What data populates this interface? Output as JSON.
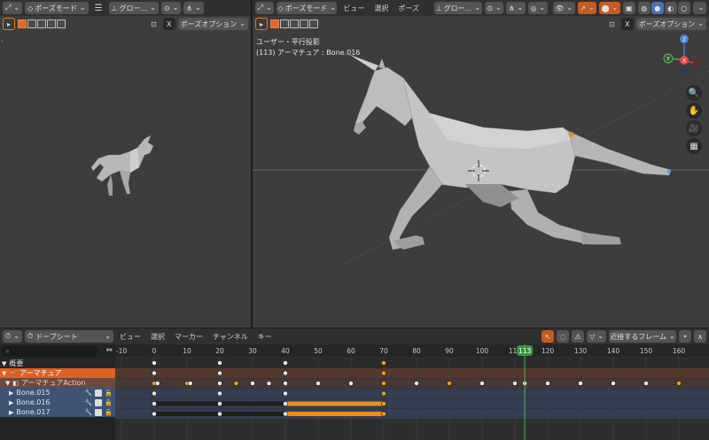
{
  "left_viewport": {
    "mode_label": "ポーズモード",
    "transform_label": "グロー...",
    "options_label": "ポーズオプション"
  },
  "main_viewport": {
    "mode_label": "ポーズモード",
    "menus": [
      "ビュー",
      "選択",
      "ポーズ"
    ],
    "transform_label": "グロー...",
    "options_label": "ポーズオプション",
    "view_info": "ユーザー・平行投影",
    "selection_info": "(113) アーマチュア : Bone.016",
    "gizmo": {
      "y": "Y",
      "x": "X",
      "z": "Z"
    }
  },
  "dopesheet": {
    "editor_label": "ドープシート",
    "menus": [
      "ビュー",
      "選択",
      "マーカー",
      "チャンネル",
      "キー"
    ],
    "snap_label": "近接するフレーム",
    "search_placeholder": "",
    "ruler_ticks": [
      -10,
      0,
      10,
      20,
      30,
      40,
      50,
      60,
      70,
      80,
      90,
      100,
      110,
      120,
      130,
      140,
      150,
      160
    ],
    "current_frame": 113,
    "channels": [
      {
        "label": "概要",
        "type": "summary"
      },
      {
        "label": "アーマチュア",
        "type": "object"
      },
      {
        "label": "アーマチュアAction",
        "type": "action"
      },
      {
        "label": "Bone.015",
        "type": "bone"
      },
      {
        "label": "Bone.016",
        "type": "bone"
      },
      {
        "label": "Bone.017",
        "type": "bone"
      }
    ],
    "keyframes": [
      {
        "row": 0,
        "frames": [
          0,
          20,
          40,
          70
        ],
        "selected": [
          70
        ]
      },
      {
        "row": 1,
        "frames": [
          0,
          20,
          40,
          70
        ],
        "selected": [
          70
        ]
      },
      {
        "row": 2,
        "frames": [
          0,
          1,
          10,
          11,
          20,
          25,
          30,
          35,
          40,
          50,
          60,
          70,
          80,
          90,
          100,
          110,
          113,
          120,
          130,
          140,
          150,
          160
        ],
        "selected": [
          0,
          10,
          25,
          70,
          90,
          160
        ]
      },
      {
        "row": 3,
        "frames": [
          0,
          20,
          40,
          70
        ],
        "selected": [
          70
        ]
      },
      {
        "row": 4,
        "frames": [
          0,
          20,
          40,
          70
        ],
        "selected": [
          70
        ]
      },
      {
        "row": 5,
        "frames": [
          0,
          20,
          40,
          70
        ],
        "selected": [
          70
        ]
      }
    ],
    "holds": [
      {
        "row": 4,
        "from": 0,
        "to": 40,
        "selected": false
      },
      {
        "row": 4,
        "from": 40,
        "to": 70,
        "selected": true
      },
      {
        "row": 5,
        "from": 0,
        "to": 40,
        "selected": false
      },
      {
        "row": 5,
        "from": 40,
        "to": 70,
        "selected": true
      }
    ]
  }
}
